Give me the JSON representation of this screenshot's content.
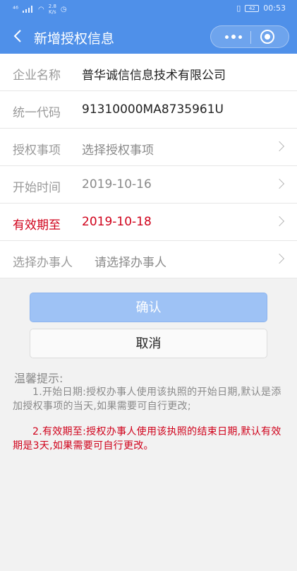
{
  "statusbar": {
    "signal": "⁴⁶",
    "speed_value": "2.8",
    "speed_unit": "K/s",
    "time": "00:53",
    "battery": "42"
  },
  "navbar": {
    "title": "新增授权信息"
  },
  "form": {
    "company_name": {
      "label": "企业名称",
      "value": "普华诚信信息技术有限公司"
    },
    "unified_code": {
      "label": "统一代码",
      "value": "91310000MA8735961U"
    },
    "auth_item": {
      "label": "授权事项",
      "value": "选择授权事项"
    },
    "start_time": {
      "label": "开始时间",
      "value": "2019-10-16"
    },
    "valid_until": {
      "label": "有效期至",
      "value": "2019-10-18"
    },
    "handler": {
      "label": "选择办事人",
      "value": "请选择办事人"
    }
  },
  "buttons": {
    "confirm": "确认",
    "cancel": "取消"
  },
  "tips": {
    "title": "温馨提示:",
    "tip1": "1.开始日期:授权办事人使用该执照的开始日期,默认是添加授权事项的当天,如果需要可自行更改;",
    "tip2": "2.有效期至:授权办事人使用该执照的结束日期,默认有效期是3天,如果需要可自行更改。"
  },
  "colors": {
    "header": "#4f90e9",
    "accent_red": "#d0021b",
    "confirm_button": "#9ec2f5"
  }
}
